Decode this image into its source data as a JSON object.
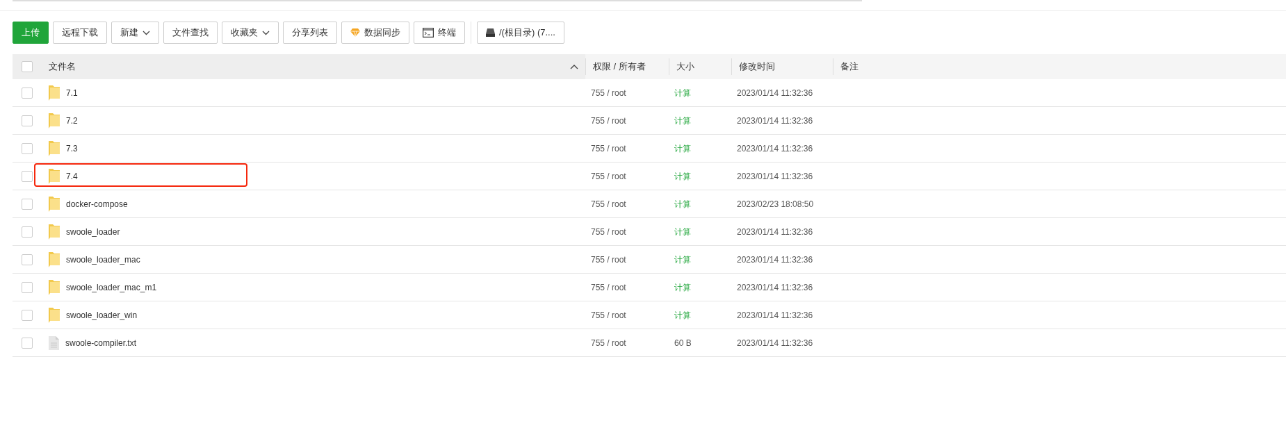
{
  "toolbar": [
    {
      "label": "上传",
      "kind": "primary"
    },
    {
      "label": "远程下载",
      "kind": "plain"
    },
    {
      "label": "新建",
      "kind": "dropdown"
    },
    {
      "label": "文件查找",
      "kind": "plain"
    },
    {
      "label": "收藏夹",
      "kind": "dropdown"
    },
    {
      "label": "分享列表",
      "kind": "plain"
    },
    {
      "label": "数据同步",
      "kind": "sync"
    },
    {
      "label": "终端",
      "kind": "terminal"
    },
    {
      "label": "/(根目录) (7....",
      "kind": "disk"
    }
  ],
  "table": {
    "select_all": {
      "checked": false
    },
    "columns": [
      "文件名",
      "权限 / 所有者",
      "大小",
      "修改时间",
      "备注"
    ],
    "rows": [
      {
        "name": "7.1",
        "kind": "folder",
        "checked": false,
        "highlighted": false,
        "perms": "755 / root",
        "size": "计算",
        "size_link": true,
        "modified": "2023/01/14 11:32:36"
      },
      {
        "name": "7.2",
        "kind": "folder",
        "checked": false,
        "highlighted": false,
        "perms": "755 / root",
        "size": "计算",
        "size_link": true,
        "modified": "2023/01/14 11:32:36"
      },
      {
        "name": "7.3",
        "kind": "folder",
        "checked": false,
        "highlighted": false,
        "perms": "755 / root",
        "size": "计算",
        "size_link": true,
        "modified": "2023/01/14 11:32:36"
      },
      {
        "name": "7.4",
        "kind": "folder",
        "checked": false,
        "highlighted": true,
        "perms": "755 / root",
        "size": "计算",
        "size_link": true,
        "modified": "2023/01/14 11:32:36"
      },
      {
        "name": "docker-compose",
        "kind": "folder",
        "checked": false,
        "highlighted": false,
        "perms": "755 / root",
        "size": "计算",
        "size_link": true,
        "modified": "2023/02/23 18:08:50"
      },
      {
        "name": "swoole_loader",
        "kind": "folder",
        "checked": false,
        "highlighted": false,
        "perms": "755 / root",
        "size": "计算",
        "size_link": true,
        "modified": "2023/01/14 11:32:36"
      },
      {
        "name": "swoole_loader_mac",
        "kind": "folder",
        "checked": false,
        "highlighted": false,
        "perms": "755 / root",
        "size": "计算",
        "size_link": true,
        "modified": "2023/01/14 11:32:36"
      },
      {
        "name": "swoole_loader_mac_m1",
        "kind": "folder",
        "checked": false,
        "highlighted": false,
        "perms": "755 / root",
        "size": "计算",
        "size_link": true,
        "modified": "2023/01/14 11:32:36"
      },
      {
        "name": "swoole_loader_win",
        "kind": "folder",
        "checked": false,
        "highlighted": false,
        "perms": "755 / root",
        "size": "计算",
        "size_link": true,
        "modified": "2023/01/14 11:32:36"
      },
      {
        "name": "swoole-compiler.txt",
        "kind": "file",
        "checked": false,
        "highlighted": false,
        "perms": "755 / root",
        "size": "60 B",
        "size_link": false,
        "modified": "2023/01/14 11:32:36"
      }
    ]
  }
}
